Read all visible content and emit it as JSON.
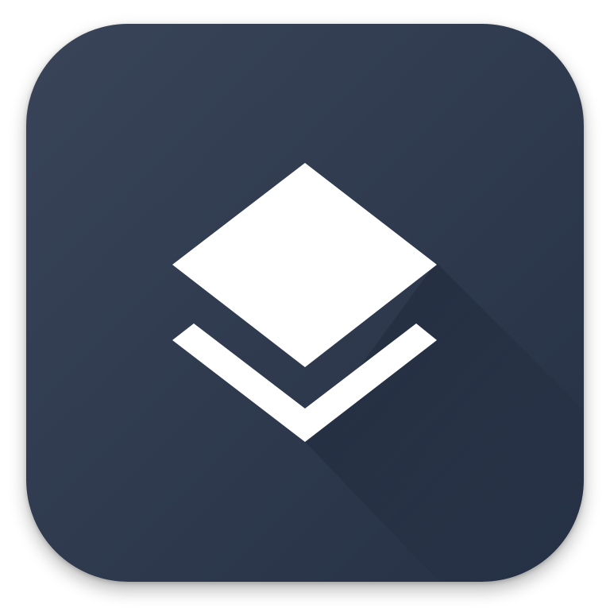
{
  "icon": {
    "name": "layers-icon",
    "colors": {
      "background_top": "#394458",
      "background_bottom": "#263146",
      "glyph": "#ffffff",
      "long_shadow": "#1f2839"
    }
  }
}
